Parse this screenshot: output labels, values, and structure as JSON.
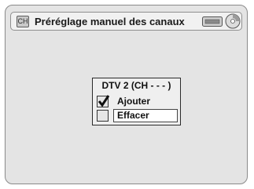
{
  "header": {
    "channel_icon_text": "CH",
    "title": "Préréglage manuel des canaux",
    "icons": [
      "channel-icon",
      "input-source-icon",
      "disc-icon"
    ]
  },
  "dialog": {
    "heading": "DTV  2 (CH - - - )",
    "options": [
      {
        "label": "Ajouter",
        "checked": true,
        "highlighted": false
      },
      {
        "label": "Effacer",
        "checked": false,
        "highlighted": true
      }
    ]
  }
}
